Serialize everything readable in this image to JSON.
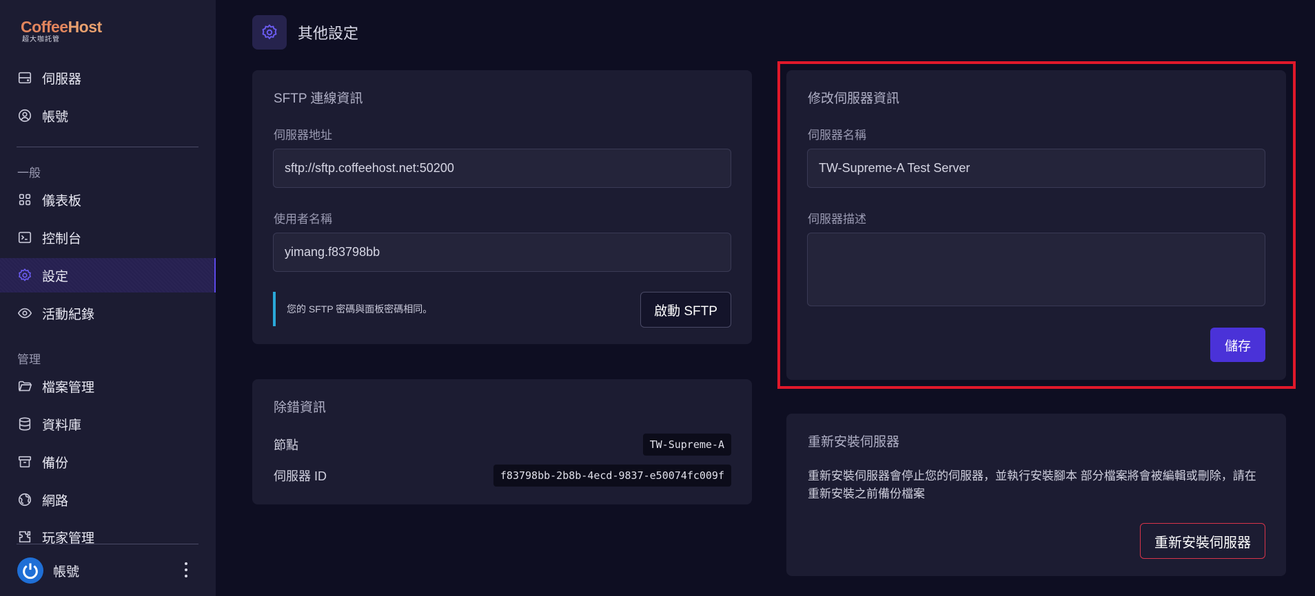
{
  "brand": {
    "coffee": "Coffee",
    "host": "Host",
    "sub": "超大咖託管"
  },
  "sidebar": {
    "top_items": [
      {
        "label": "伺服器",
        "icon": "server-icon"
      },
      {
        "label": "帳號",
        "icon": "user-circle-icon"
      }
    ],
    "section_general": "一般",
    "general_items": [
      {
        "label": "儀表板",
        "icon": "grid-icon"
      },
      {
        "label": "控制台",
        "icon": "terminal-icon"
      },
      {
        "label": "設定",
        "icon": "gear-icon",
        "active": true
      },
      {
        "label": "活動紀錄",
        "icon": "eye-icon"
      }
    ],
    "section_manage": "管理",
    "manage_items": [
      {
        "label": "檔案管理",
        "icon": "folder-icon"
      },
      {
        "label": "資料庫",
        "icon": "database-icon"
      },
      {
        "label": "備份",
        "icon": "archive-icon"
      },
      {
        "label": "網路",
        "icon": "globe-icon"
      },
      {
        "label": "玩家管理",
        "icon": "puzzle-icon"
      }
    ],
    "account_label": "帳號"
  },
  "page": {
    "title": "其他設定"
  },
  "sftp": {
    "title": "SFTP 連線資訊",
    "address_label": "伺服器地址",
    "address_value": "sftp://sftp.coffeehost.net:50200",
    "username_label": "使用者名稱",
    "username_value": "yimang.f83798bb",
    "note": "您的 SFTP 密碼與面板密碼相同。",
    "launch_button": "啟動 SFTP"
  },
  "debug": {
    "title": "除錯資訊",
    "node_label": "節點",
    "node_value": "TW-Supreme-A",
    "id_label": "伺服器 ID",
    "id_value": "f83798bb-2b8b-4ecd-9837-e50074fc009f"
  },
  "edit_server": {
    "title": "修改伺服器資訊",
    "name_label": "伺服器名稱",
    "name_value": "TW-Supreme-A Test Server",
    "desc_label": "伺服器描述",
    "desc_value": "",
    "save_button": "儲存"
  },
  "reinstall": {
    "title": "重新安裝伺服器",
    "description": "重新安裝伺服器會停止您的伺服器，並執行安裝腳本 部分檔案將會被編輯或刪除，請在重新安裝之前備份檔案",
    "button": "重新安裝伺服器"
  },
  "colors": {
    "accent": "#4a32d8",
    "danger": "#d8344a",
    "highlight": "#e0182a",
    "info": "#2aa8d8"
  }
}
